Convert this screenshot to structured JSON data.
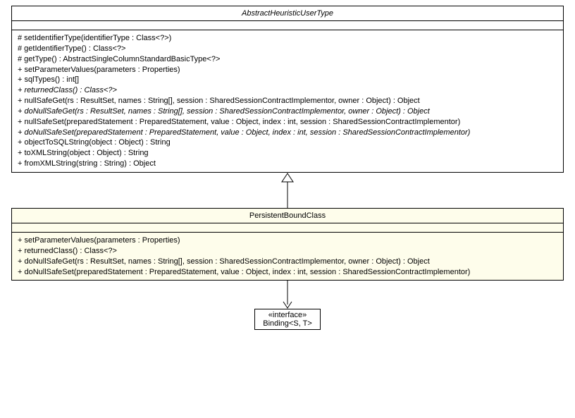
{
  "parent": {
    "name": "AbstractHeuristicUserType",
    "operations": [
      {
        "sig": "# setIdentifierType(identifierType : Class<?>)",
        "abstract": false
      },
      {
        "sig": "# getIdentifierType() : Class<?>",
        "abstract": false
      },
      {
        "sig": "# getType() : AbstractSingleColumnStandardBasicType<?>",
        "abstract": false
      },
      {
        "sig": "+ setParameterValues(parameters : Properties)",
        "abstract": false
      },
      {
        "sig": "+ sqlTypes() : int[]",
        "abstract": false
      },
      {
        "sig": "+ returnedClass() : Class<?>",
        "abstract": true
      },
      {
        "sig": "+ nullSafeGet(rs : ResultSet, names : String[], session : SharedSessionContractImplementor, owner : Object) : Object",
        "abstract": false
      },
      {
        "sig": "+ doNullSafeGet(rs : ResultSet, names : String[], session : SharedSessionContractImplementor, owner : Object) : Object",
        "abstract": true
      },
      {
        "sig": "+ nullSafeSet(preparedStatement : PreparedStatement, value : Object, index : int, session : SharedSessionContractImplementor)",
        "abstract": false
      },
      {
        "sig": "+ doNullSafeSet(preparedStatement : PreparedStatement, value : Object, index : int, session : SharedSessionContractImplementor)",
        "abstract": true
      },
      {
        "sig": "+ objectToSQLString(object : Object) : String",
        "abstract": false
      },
      {
        "sig": "+ toXMLString(object : Object) : String",
        "abstract": false
      },
      {
        "sig": "+ fromXMLString(string : String) : Object",
        "abstract": false
      }
    ]
  },
  "child": {
    "name": "PersistentBoundClass",
    "operations": [
      {
        "sig": "+ setParameterValues(parameters : Properties)",
        "abstract": false
      },
      {
        "sig": "+ returnedClass() : Class<?>",
        "abstract": false
      },
      {
        "sig": "+ doNullSafeGet(rs : ResultSet, names : String[], session : SharedSessionContractImplementor, owner : Object) : Object",
        "abstract": false
      },
      {
        "sig": "+ doNullSafeSet(preparedStatement : PreparedStatement, value : Object, index : int, session : SharedSessionContractImplementor)",
        "abstract": false
      }
    ]
  },
  "iface": {
    "stereotype": "«interface»",
    "name": "Binding<S, T>"
  }
}
